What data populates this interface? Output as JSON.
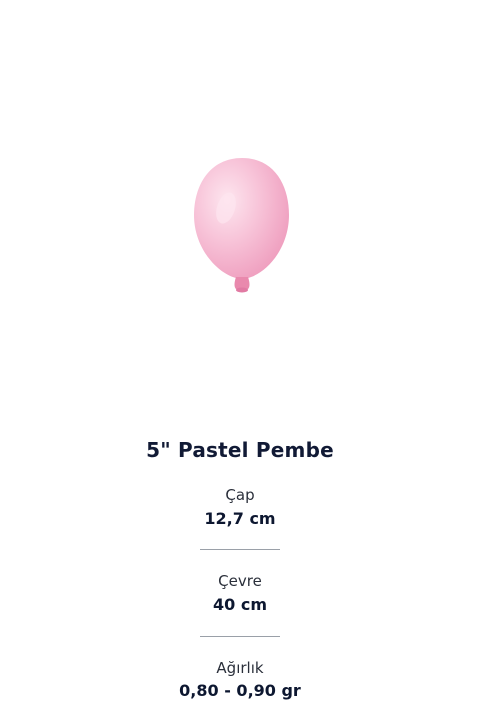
{
  "product": {
    "title": "5\" Pastel Pembe",
    "image_alt_color": "#f6bcd4"
  },
  "specs": [
    {
      "label": "Çap",
      "value": "12,7 cm"
    },
    {
      "label": "Çevre",
      "value": "40 cm"
    },
    {
      "label": "Ağırlık",
      "value": "0,80 - 0,90 gr"
    }
  ],
  "colors": {
    "balloon": "#f6bcd4",
    "balloon_highlight": "#fde6ef",
    "balloon_knot": "#e989ad",
    "text_dark": "#111a35",
    "divider": "#9aa0a8"
  }
}
